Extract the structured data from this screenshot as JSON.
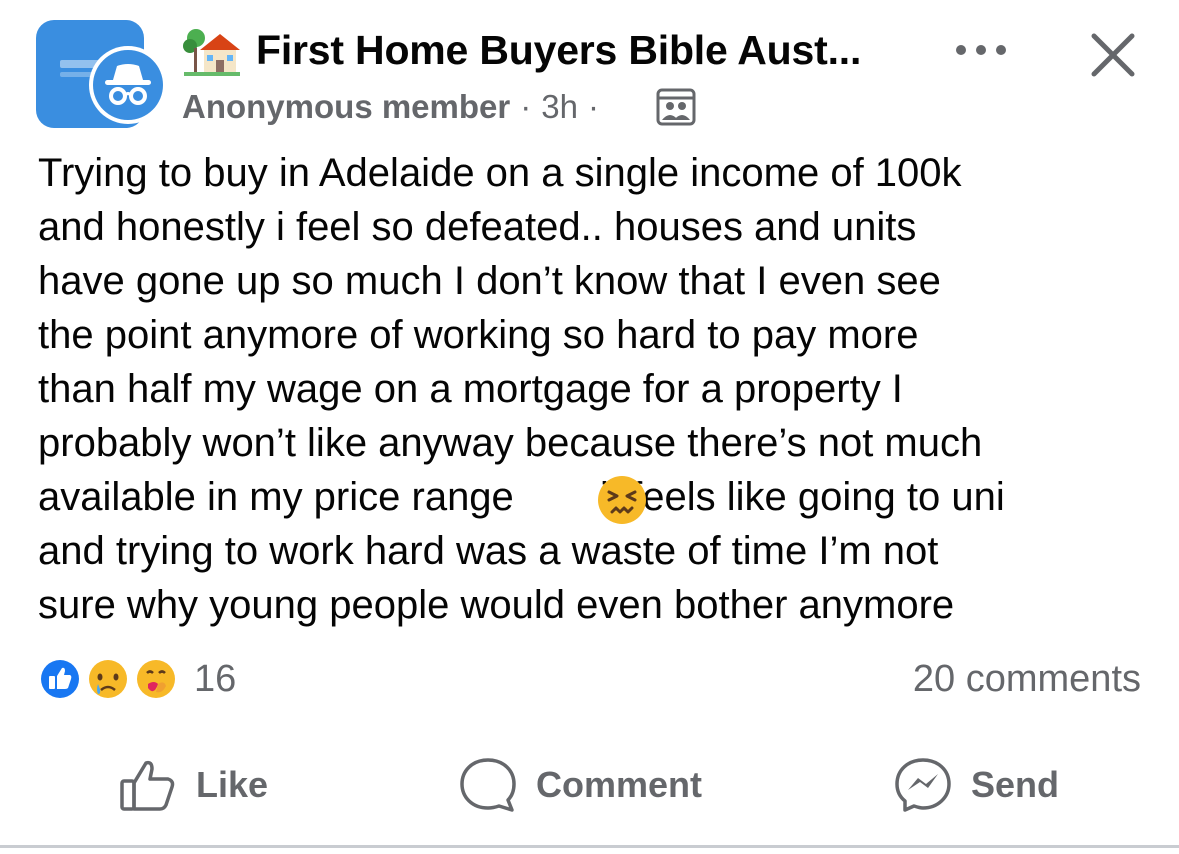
{
  "header": {
    "group_name": "First Home Buyers Bible Aust...",
    "group_avatar_icon": "group-logo-icon",
    "author": "Anonymous member",
    "separator": "·",
    "time": "3h",
    "audience_icon": "group-members-icon"
  },
  "post": {
    "text_before_emoji": "Trying to buy in Adelaide on a single income of 100k\nand honestly i feel so defeated.. houses and units\nhave gone up so much I don’t know that I even see\nthe point anymore of working so hard to pay more\nthan half my wage on a mortgage for a property I\nprobably won’t like anyway because there’s not much\navailable in my price range ",
    "emoji": "persevering-face-icon",
    "text_after_emoji": " it feels like going to uni\nand trying to work hard was a waste of time I’m not\nsure why young people would even bother anymore"
  },
  "stats": {
    "reaction_icons": [
      "like-icon",
      "sad-icon",
      "care-icon"
    ],
    "reaction_count": "16",
    "comments": "20 comments"
  },
  "actions": {
    "like": "Like",
    "comment": "Comment",
    "send": "Send"
  },
  "colors": {
    "facebook_blue": "#1877f2",
    "group_avatar": "#3a8ee0",
    "secondary_text": "#65676b",
    "emoji_yellow": "#f7b928"
  }
}
